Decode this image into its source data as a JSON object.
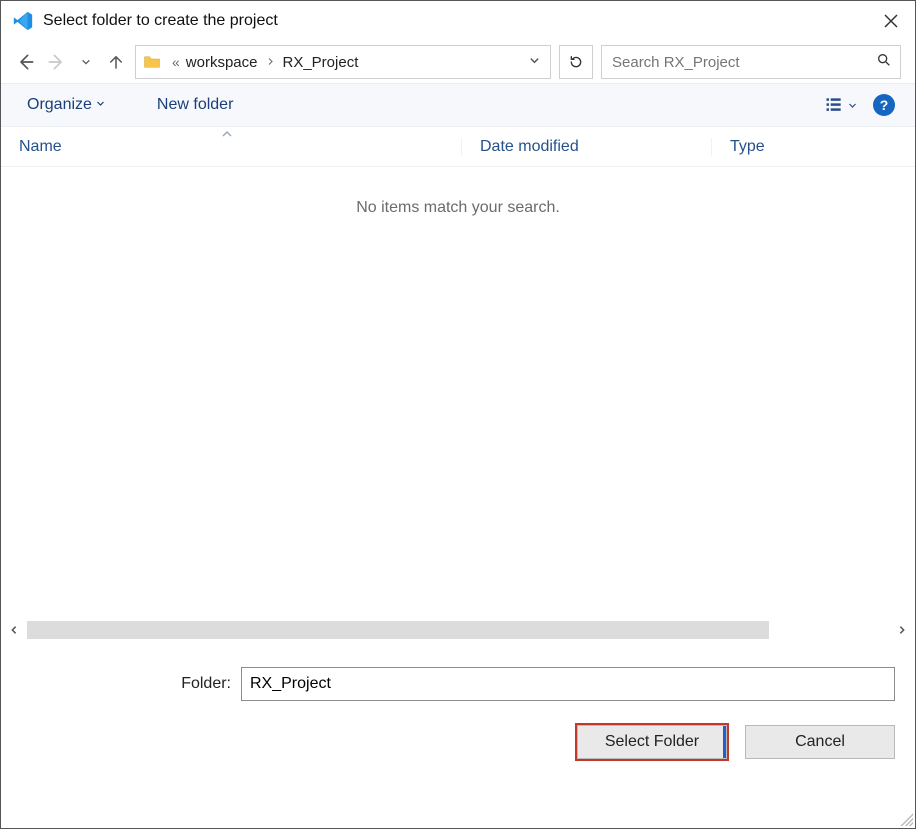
{
  "title": "Select folder to create the project",
  "breadcrumb": {
    "segments": [
      "workspace",
      "RX_Project"
    ]
  },
  "search": {
    "placeholder": "Search RX_Project"
  },
  "toolbar": {
    "organize_label": "Organize",
    "new_folder_label": "New folder"
  },
  "columns": {
    "name": "Name",
    "date": "Date modified",
    "type": "Type"
  },
  "filelist": {
    "empty_message": "No items match your search."
  },
  "folder_input": {
    "label": "Folder:",
    "value": "RX_Project"
  },
  "buttons": {
    "select": "Select Folder",
    "cancel": "Cancel"
  }
}
